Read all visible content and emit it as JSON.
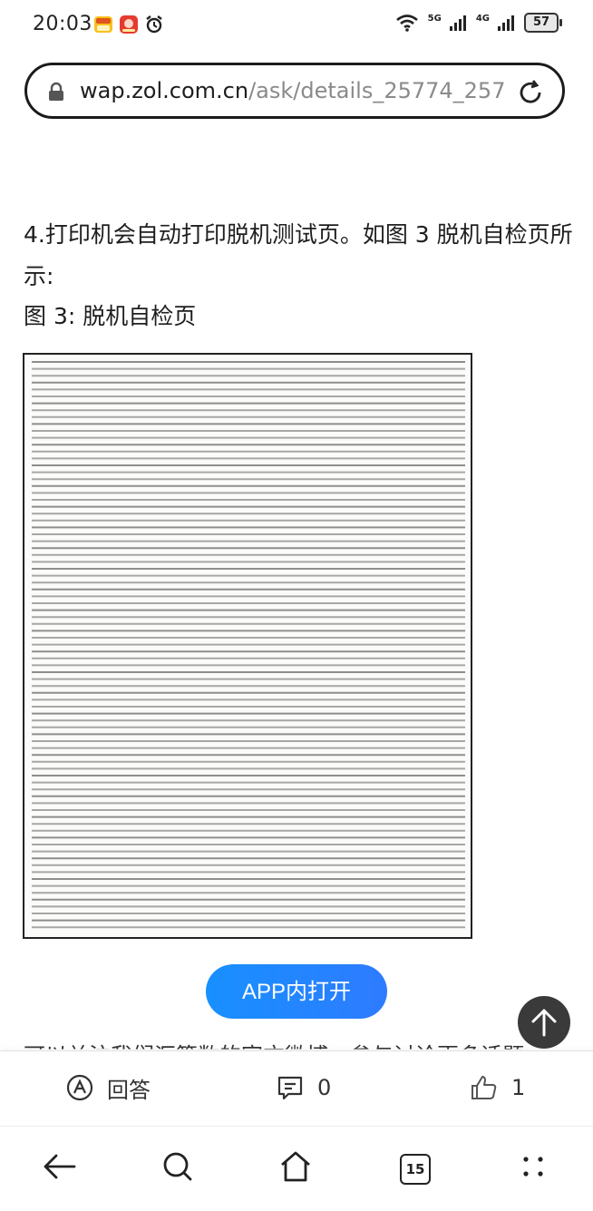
{
  "status_bar": {
    "time": "20:03",
    "signal_1": "5G",
    "signal_2": "4G",
    "battery": "57"
  },
  "address_bar": {
    "host": "wap.zol.com.cn",
    "path": "/ask/details_25774_257"
  },
  "article": {
    "step_text": "4.打印机会自动打印脱机测试页。如图 3 脱机自检页所示:",
    "figure_caption": "图 3: 脱机自检页",
    "truncated_text": "可以关注我们汇算数的官方微博，参与讨论更多话题"
  },
  "buttons": {
    "open_in_app": "APP内打开"
  },
  "action_bar": {
    "answer_label": "回答",
    "comment_count": "0",
    "like_count": "1"
  },
  "browser_nav": {
    "tab_count": "15"
  },
  "colors": {
    "accent": "#1890ff",
    "text": "#1e1e1e",
    "url_path": "#8a8a8a"
  }
}
